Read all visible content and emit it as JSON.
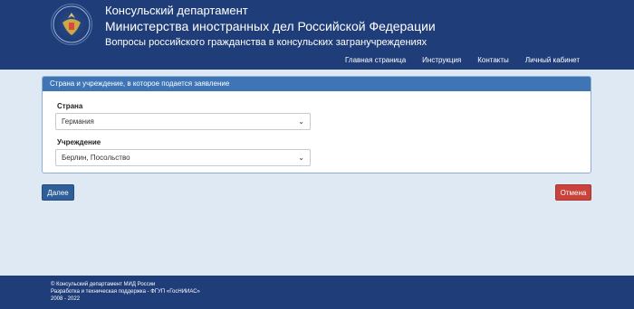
{
  "header": {
    "line1": "Консульский департамент",
    "line2": "Министерства иностранных дел Российской Федерации",
    "line3": "Вопросы российского гражданства в консульских загранучреждениях"
  },
  "nav": {
    "items": [
      "Главная страница",
      "Инструкция",
      "Контакты",
      "Личный кабинет"
    ]
  },
  "panel": {
    "title": "Страна и учреждение, в которое подается заявление",
    "country_label": "Страна",
    "country_value": "Германия",
    "institution_label": "Учреждение",
    "institution_value": "Берлин, Посольство"
  },
  "buttons": {
    "next": "Далее",
    "cancel": "Отмена"
  },
  "footer": {
    "line1": "© Консульский департамент МИД России",
    "line2": "Разработка и техническая поддержка - ФГУП «ГосНИИАС»",
    "line3": "2008 - 2022"
  },
  "colors": {
    "header_bg": "#1f3d78",
    "panel_head_bg": "#3f74b5",
    "next_btn": "#2f5f98",
    "cancel_btn": "#c9423b",
    "page_bg": "#dfe9f4"
  },
  "icons": {
    "emblem": "mfa-emblem-icon",
    "select_chevron": "chevron-down-icon"
  }
}
